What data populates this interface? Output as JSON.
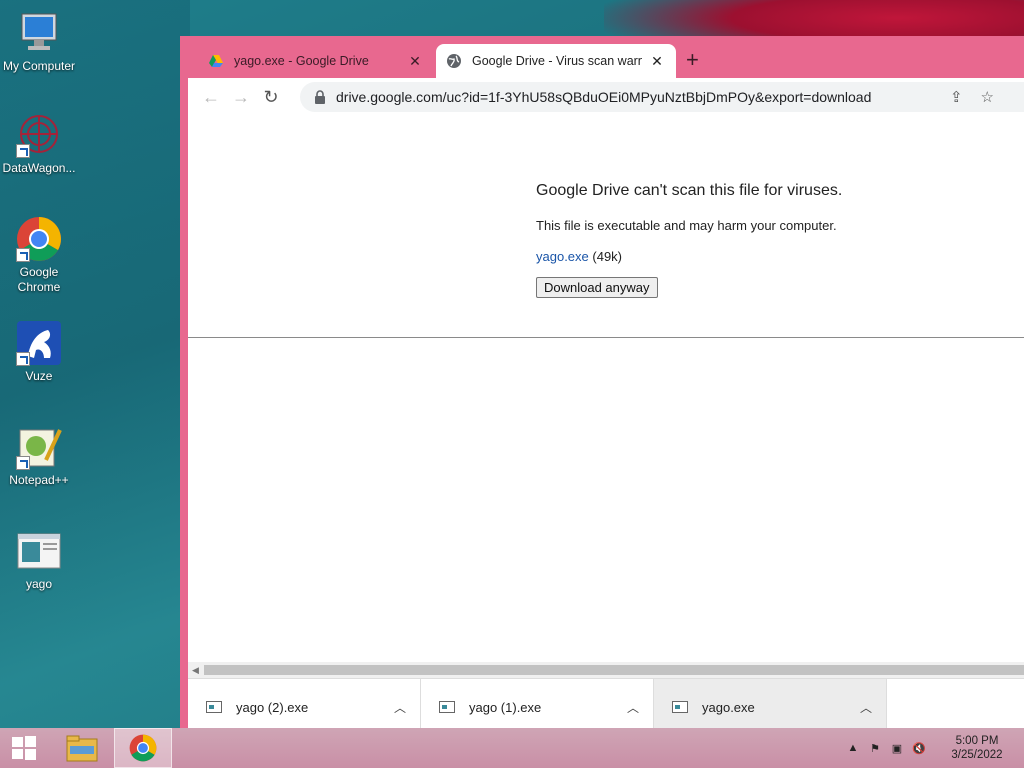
{
  "desktop": {
    "icons": [
      {
        "label": "My Computer"
      },
      {
        "label": "DataWagon..."
      },
      {
        "label": "Google Chrome"
      },
      {
        "label": "Vuze"
      },
      {
        "label": "Notepad++"
      },
      {
        "label": "yago"
      }
    ]
  },
  "browser": {
    "tabs": [
      {
        "title": "yago.exe - Google Drive",
        "icon": "google-drive-icon",
        "active": false
      },
      {
        "title": "Google Drive - Virus scan warning",
        "icon": "globe-icon",
        "active": true
      }
    ],
    "new_tab": "+",
    "address": "drive.google.com/uc?id=1f-3YhU58sQBduOEi0MPyuNztBbjDmPOy&export=download"
  },
  "page": {
    "heading": "Google Drive can't scan this file for viruses.",
    "description": "This file is executable and may harm your computer.",
    "file_name": "yago.exe",
    "file_size": "(49k)",
    "download_button": "Download anyway"
  },
  "downloads": [
    {
      "name": "yago (2).exe"
    },
    {
      "name": "yago (1).exe"
    },
    {
      "name": "yago.exe"
    }
  ],
  "taskbar": {
    "time": "5:00 PM",
    "date": "3/25/2022"
  }
}
